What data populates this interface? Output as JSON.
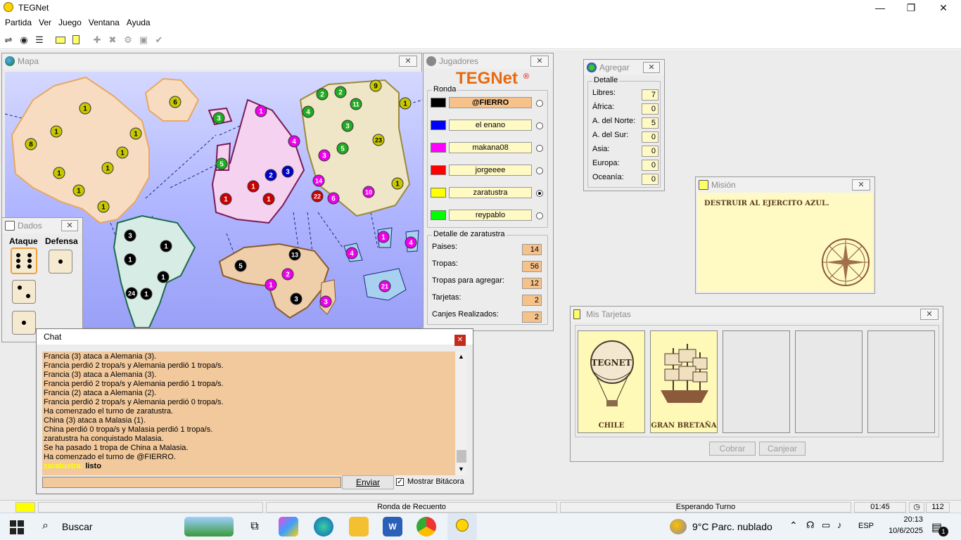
{
  "app": {
    "title": "TEGNet"
  },
  "menu": [
    "Partida",
    "Ver",
    "Juego",
    "Ventana",
    "Ayuda"
  ],
  "windows": {
    "mapa": {
      "title": "Mapa"
    },
    "dados": {
      "title": "Dados",
      "ataque": "Ataque",
      "defensa": "Defensa"
    },
    "jugadores": {
      "title": "Jugadores",
      "logo": "TEGNet",
      "logo_mark": "®",
      "ronda": "Ronda",
      "players": [
        {
          "name": "@FIERRO",
          "color": "#000000",
          "selected": false,
          "active": true
        },
        {
          "name": "el enano",
          "color": "#0000ff",
          "selected": false,
          "active": false
        },
        {
          "name": "makana08",
          "color": "#ff00ff",
          "selected": false,
          "active": false
        },
        {
          "name": "jorgeeee",
          "color": "#ff0000",
          "selected": false,
          "active": false
        },
        {
          "name": "zaratustra",
          "color": "#ffff00",
          "selected": true,
          "active": false
        },
        {
          "name": "reypablo",
          "color": "#00ff00",
          "selected": false,
          "active": false
        }
      ],
      "detalle_title": "Detalle de zaratustra",
      "detalle": [
        {
          "label": "Paises:",
          "value": "14"
        },
        {
          "label": "Tropas:",
          "value": "56"
        },
        {
          "label": "Tropas para agregar:",
          "value": "12"
        },
        {
          "label": "Tarjetas:",
          "value": "2"
        },
        {
          "label": "Canjes Realizados:",
          "value": "2"
        }
      ]
    },
    "agregar": {
      "title": "Agregar",
      "detalle": "Detalle",
      "rows": [
        {
          "label": "Libres:",
          "value": "7"
        },
        {
          "label": "África:",
          "value": "0"
        },
        {
          "label": "A. del Norte:",
          "value": "5"
        },
        {
          "label": "A. del Sur:",
          "value": "0"
        },
        {
          "label": "Asia:",
          "value": "0"
        },
        {
          "label": "Europa:",
          "value": "0"
        },
        {
          "label": "Oceanía:",
          "value": "0"
        }
      ]
    },
    "mision": {
      "title": "Misión",
      "text": "DESTRUIR AL EJERCITO AZUL."
    },
    "tarjetas": {
      "title": "Mis Tarjetas",
      "cards": [
        "CHILE",
        "GRAN BRETAÑA",
        "",
        "",
        ""
      ],
      "cobrar": "Cobrar",
      "canjear": "Canjear",
      "card_logo": "TEGNET"
    },
    "chat": {
      "title": "Chat",
      "lines": [
        "Francia (3) ataca a Alemania (3).",
        "Francia perdió 2 tropa/s y Alemania perdió 1 tropa/s.",
        "Francia (3) ataca a Alemania (3).",
        "Francia perdió 2 tropa/s y Alemania perdió 1 tropa/s.",
        "Francia (2) ataca a Alemania (2).",
        "Francia perdió 2 tropa/s y Alemania perdió 0 tropa/s.",
        "Ha comenzado el turno de zaratustra.",
        "China (3) ataca a Malasia (1).",
        "China perdió 0 tropa/s y Malasia perdió 1 tropa/s.",
        "zaratustra ha conquistado Malasia.",
        "Se ha pasado 1 tropa de China a Malasia.",
        "Ha comenzado el turno de @FIERRO."
      ],
      "last_user": "zaratustra:",
      "last_msg": "listo",
      "enviar": "Enviar",
      "mostrar": "Mostrar Bitácora"
    }
  },
  "statusbar": {
    "ronda": "Ronda de Recuento",
    "estado": "Esperando Turno",
    "time": "01:45",
    "count": "112"
  },
  "taskbar": {
    "search": "Buscar",
    "weather": "9°C  Parc. nublado",
    "lang": "ESP",
    "clock": "20:13",
    "date": "10/6/2025",
    "badge": "1"
  },
  "map_armies": [
    {
      "v": "1",
      "c": "#c8c800"
    },
    {
      "v": "6",
      "c": "#c8c800"
    },
    {
      "v": "1",
      "c": "#c8c800"
    },
    {
      "v": "1",
      "c": "#c8c800"
    },
    {
      "v": "8",
      "c": "#c8c800"
    },
    {
      "v": "1",
      "c": "#c8c800"
    },
    {
      "v": "1",
      "c": "#c8c800"
    },
    {
      "v": "1",
      "c": "#c8c800"
    },
    {
      "v": "1",
      "c": "#c8c800"
    },
    {
      "v": "1",
      "c": "#c8c800"
    },
    {
      "v": "3",
      "c": "#22aa22"
    },
    {
      "v": "5",
      "c": "#22aa22"
    },
    {
      "v": "1",
      "c": "#ee00ee"
    },
    {
      "v": "4",
      "c": "#ee00ee"
    },
    {
      "v": "3",
      "c": "#ee00ee"
    },
    {
      "v": "2",
      "c": "#0000cc"
    },
    {
      "v": "3",
      "c": "#0000cc"
    },
    {
      "v": "1",
      "c": "#cc0000"
    },
    {
      "v": "1",
      "c": "#cc0000"
    },
    {
      "v": "1",
      "c": "#cc0000"
    },
    {
      "v": "14",
      "c": "#ee00ee"
    },
    {
      "v": "22",
      "c": "#cc0000"
    },
    {
      "v": "6",
      "c": "#ee00ee"
    },
    {
      "v": "2",
      "c": "#22aa22"
    },
    {
      "v": "2",
      "c": "#22aa22"
    },
    {
      "v": "9",
      "c": "#c8c800"
    },
    {
      "v": "1",
      "c": "#c8c800"
    },
    {
      "v": "4",
      "c": "#22aa22"
    },
    {
      "v": "11",
      "c": "#22aa22"
    },
    {
      "v": "3",
      "c": "#22aa22"
    },
    {
      "v": "5",
      "c": "#22aa22"
    },
    {
      "v": "23",
      "c": "#c8c800"
    },
    {
      "v": "1",
      "c": "#c8c800"
    },
    {
      "v": "10",
      "c": "#ee00ee"
    },
    {
      "v": "4",
      "c": "#ee00ee"
    },
    {
      "v": "1",
      "c": "#ee00ee"
    },
    {
      "v": "4",
      "c": "#ee00ee"
    },
    {
      "v": "21",
      "c": "#ee00ee"
    },
    {
      "v": "3",
      "c": "#000000"
    },
    {
      "v": "1",
      "c": "#000000"
    },
    {
      "v": "1",
      "c": "#000000"
    },
    {
      "v": "1",
      "c": "#000000"
    },
    {
      "v": "24",
      "c": "#000000"
    },
    {
      "v": "1",
      "c": "#000000"
    },
    {
      "v": "5",
      "c": "#000000"
    },
    {
      "v": "13",
      "c": "#000000"
    },
    {
      "v": "2",
      "c": "#ee00ee"
    },
    {
      "v": "1",
      "c": "#ee00ee"
    },
    {
      "v": "3",
      "c": "#000000"
    },
    {
      "v": "3",
      "c": "#ee00ee"
    }
  ]
}
